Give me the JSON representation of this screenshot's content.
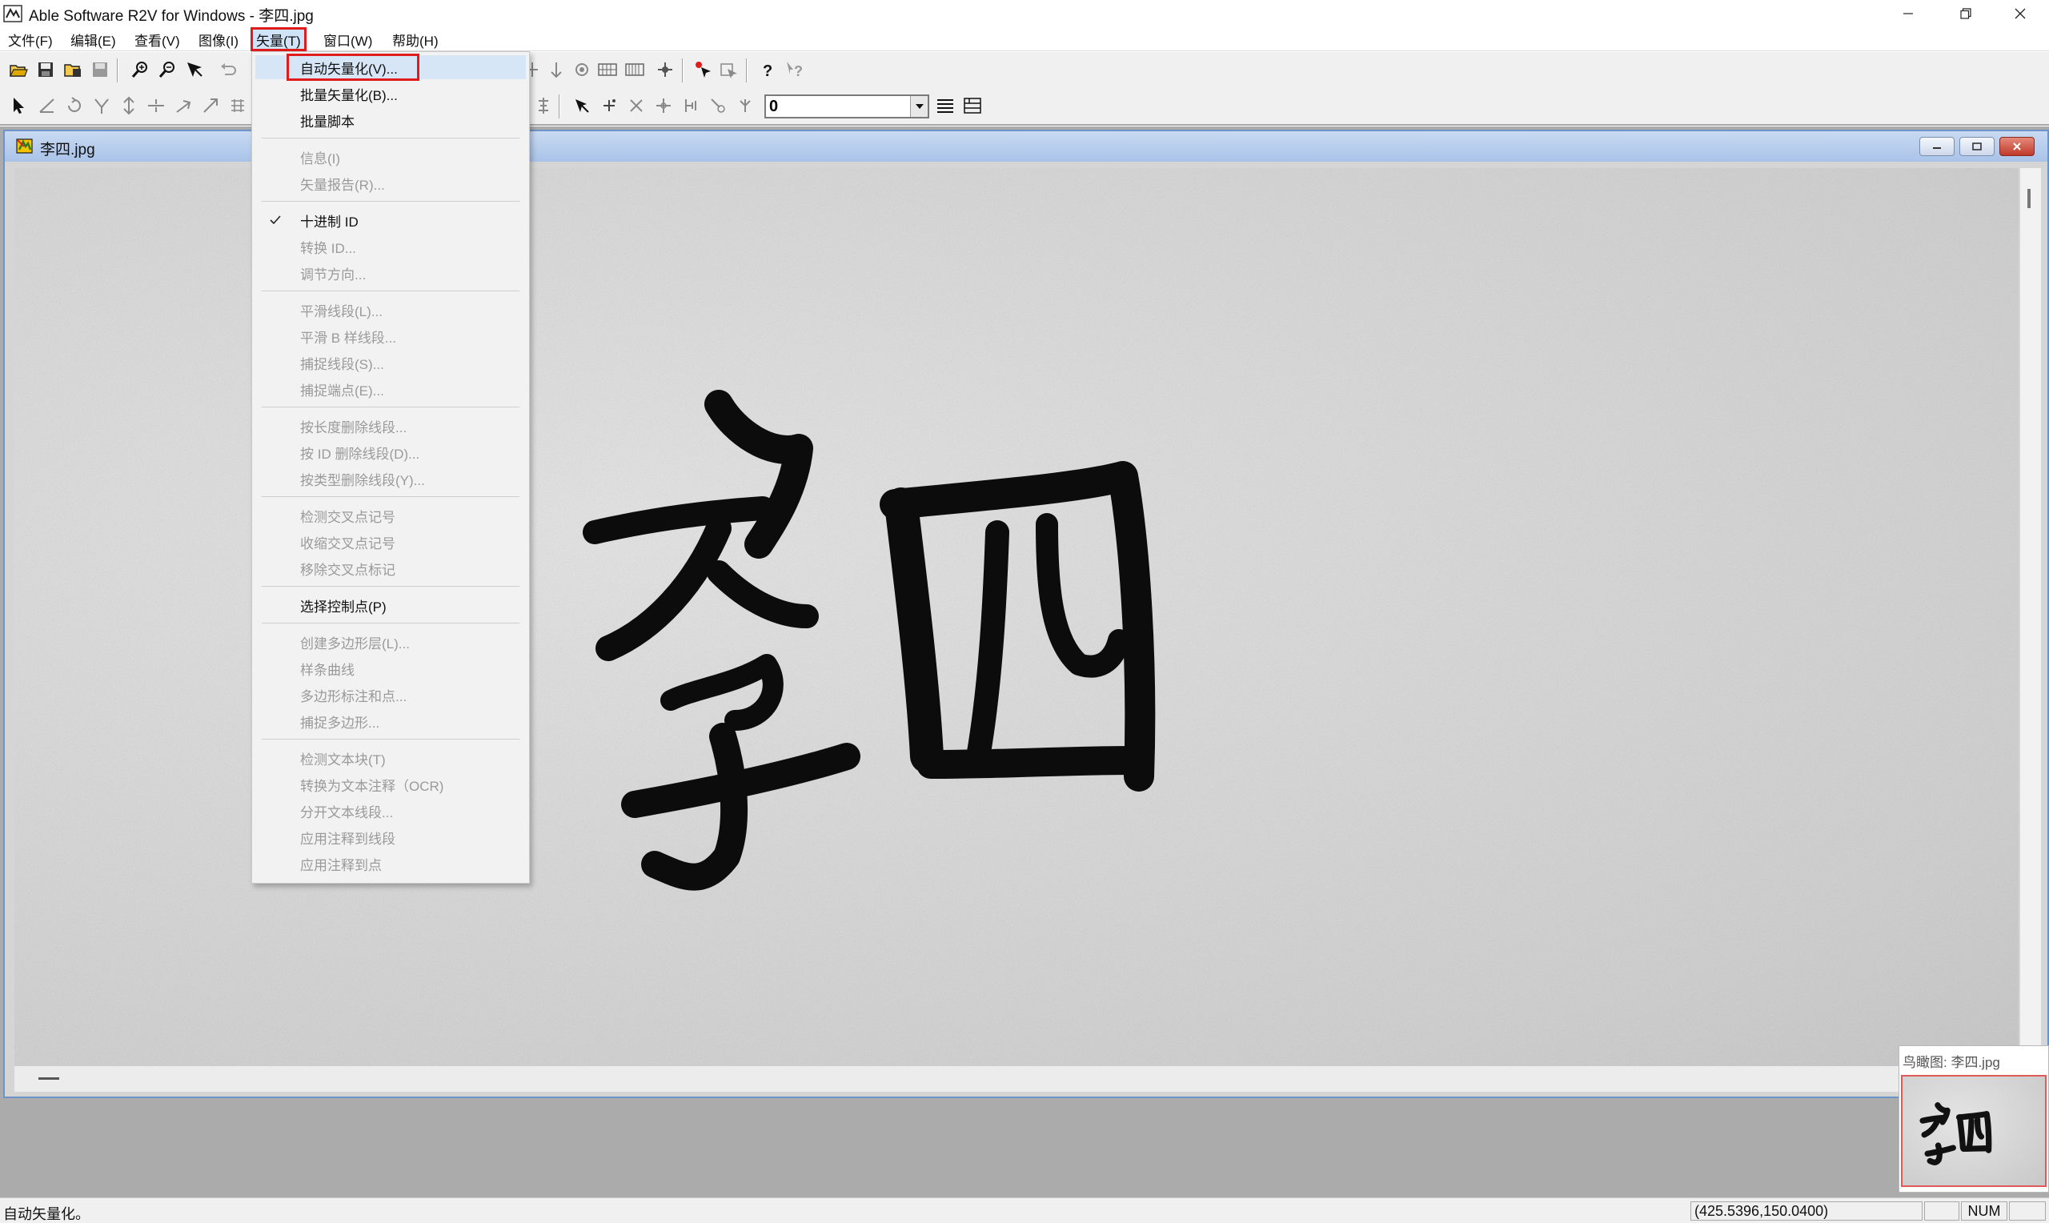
{
  "window": {
    "title": "Able Software R2V for Windows - 李四.jpg",
    "controls": [
      "minimize-icon",
      "restore-icon",
      "close-icon"
    ]
  },
  "menubar": {
    "file": "文件(F)",
    "edit": "编辑(E)",
    "view": "查看(V)",
    "image": "图像(I)",
    "vector": "矢量(T)",
    "window": "窗口(W)",
    "help": "帮助(H)"
  },
  "toolbar": {
    "id_value": "0",
    "row1_icons": [
      "open-icon",
      "save-icon",
      "open-folder-icon",
      "save-disk-icon",
      "zoom-in-icon",
      "zoom-out-icon",
      "select-arrow-icon",
      "undo-icon",
      "node-icon",
      "node-down-icon",
      "target-icon",
      "grid-icon",
      "grid-alt-icon",
      "crosshair-icon",
      "pick-icon",
      "edit-node-icon",
      "help-icon",
      "context-help-icon"
    ],
    "row2_icons": [
      "pointer-tool-icon",
      "line-tool-icon",
      "rotate-tool-icon",
      "split-tool-icon",
      "vertical-tool-icon",
      "horizontal-tool-icon",
      "angle-tool-icon",
      "join-tool-icon",
      "grid-tool-icon",
      "align-tool-icon",
      "arrow-cursor-icon",
      "add-point-icon",
      "delete-point-icon",
      "move-point-icon",
      "split-point-icon",
      "snap-point-icon",
      "link-point-icon",
      "list-icon",
      "layers-icon"
    ]
  },
  "document": {
    "title": "李四.jpg",
    "controls": [
      "doc-minimize-icon",
      "doc-maximize-icon",
      "doc-close-icon"
    ]
  },
  "vector_menu": {
    "items": [
      {
        "label": "自动矢量化(V)...",
        "enabled": true,
        "highlighted": true
      },
      {
        "label": "批量矢量化(B)...",
        "enabled": true
      },
      {
        "label": "批量脚本",
        "enabled": true
      },
      {
        "label": "信息(I)",
        "enabled": false
      },
      {
        "label": "矢量报告(R)...",
        "enabled": false
      },
      {
        "label": "十进制 ID",
        "enabled": true,
        "checked": true
      },
      {
        "label": "转换 ID...",
        "enabled": false
      },
      {
        "label": "调节方向...",
        "enabled": false
      },
      {
        "label": "平滑线段(L)...",
        "enabled": false
      },
      {
        "label": "平滑 B 样线段...",
        "enabled": false
      },
      {
        "label": "捕捉线段(S)...",
        "enabled": false
      },
      {
        "label": "捕捉端点(E)...",
        "enabled": false
      },
      {
        "label": "按长度删除线段...",
        "enabled": false
      },
      {
        "label": "按 ID 删除线段(D)...",
        "enabled": false
      },
      {
        "label": "按类型删除线段(Y)...",
        "enabled": false
      },
      {
        "label": "检测交叉点记号",
        "enabled": false
      },
      {
        "label": "收缩交叉点记号",
        "enabled": false
      },
      {
        "label": "移除交叉点标记",
        "enabled": false
      },
      {
        "label": "选择控制点(P)",
        "enabled": true
      },
      {
        "label": "创建多边形层(L)...",
        "enabled": false
      },
      {
        "label": "样条曲线",
        "enabled": false
      },
      {
        "label": "多边形标注和点...",
        "enabled": false
      },
      {
        "label": "捕捉多边形...",
        "enabled": false
      },
      {
        "label": "检测文本块(T)",
        "enabled": false
      },
      {
        "label": "转换为文本注释（OCR)",
        "enabled": false
      },
      {
        "label": "分开文本线段...",
        "enabled": false
      },
      {
        "label": "应用注释到线段",
        "enabled": false
      },
      {
        "label": "应用注释到点",
        "enabled": false
      }
    ]
  },
  "birdseye": {
    "title": "鸟瞰图: 李四.jpg"
  },
  "statusbar": {
    "message": "自动矢量化。",
    "coords": "(425.5396,150.0400)",
    "num": "NUM"
  },
  "colors": {
    "highlight_red": "#e01b1b",
    "menu_hover": "#d6e6f7",
    "doc_title_gradient_top": "#c9daf2",
    "workspace_gray": "#ababab"
  }
}
